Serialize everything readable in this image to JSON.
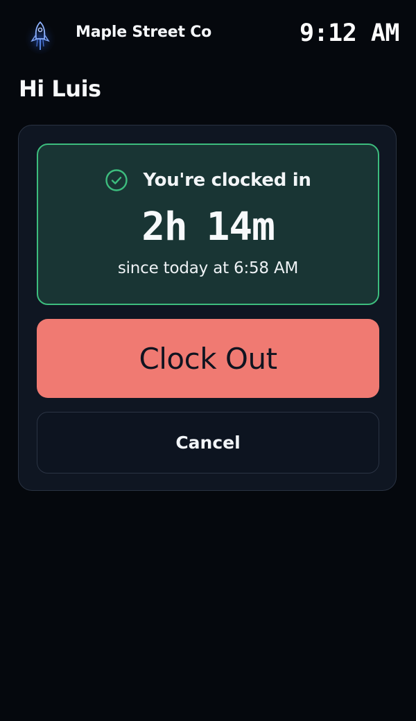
{
  "header": {
    "company_name": "Maple Street Co",
    "time": "9:12 AM",
    "logo_icon": "rocket-icon"
  },
  "greeting": "Hi Luis",
  "status": {
    "icon": "check-circle-icon",
    "label": "You're clocked in",
    "duration_hours": "2h",
    "duration_minutes": "14m",
    "since": "since today at 6:58 AM"
  },
  "actions": {
    "clock_out_label": "Clock Out",
    "cancel_label": "Cancel"
  },
  "colors": {
    "background": "#05080d",
    "panel": "#0f1622",
    "status_card": "#193534",
    "status_border": "#3dbd7e",
    "clock_out": "#f07a72"
  }
}
